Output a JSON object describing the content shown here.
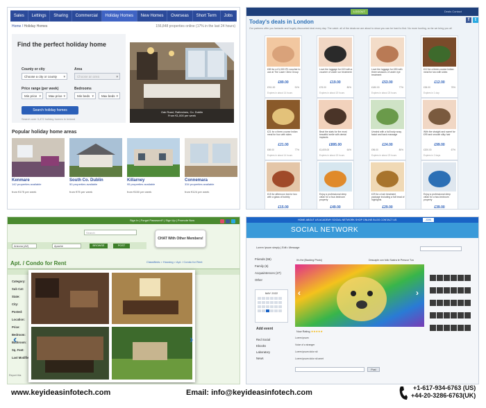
{
  "panel_holiday": {
    "nav": [
      "Sales",
      "Lettings",
      "Sharing",
      "Commercial",
      "Holiday Homes",
      "New Homes",
      "Overseas",
      "Short Term",
      "Jobs"
    ],
    "active_nav": "Holiday Homes",
    "breadcrumb_home": "Home",
    "breadcrumb_current": "Holiday Homes",
    "results_count": "156,848 properties online (17% in the last 24 hours)",
    "search": {
      "title": "Find the perfect holiday home",
      "county_label": "County or city",
      "county_value": "Choose a city or county",
      "area_label": "Area",
      "area_value": "Choose an area",
      "price_label": "Price range (per week)",
      "min_price": "Min price",
      "max_price": "Max price",
      "beds_label": "Bedrooms",
      "min_beds": "Min beds",
      "max_beds": "Max beds",
      "button": "Search holiday homes",
      "note": "Search over 3,472 holiday homes in Ireland"
    },
    "featured_caption": "Oak Road, Rathmines, Co. Dublin",
    "featured_price": "From €1,000 per week",
    "popular_title": "Popular holiday home areas",
    "areas": [
      {
        "name": "Kenmare",
        "sub": "142 properties available",
        "price": "from €175 per week"
      },
      {
        "name": "South Co. Dublin",
        "sub": "50 properties available",
        "price": "from €75 per week"
      },
      {
        "name": "Killarney",
        "sub": "95 properties available",
        "price": "from €150 per week"
      },
      {
        "name": "Connemara",
        "sub": "334 properties available",
        "price": "from €124 per week"
      }
    ]
  },
  "panel_deals": {
    "title": "Today's deals in London",
    "green_button": "LOGOUT",
    "top_links": "Deals   Contact",
    "intro": "Our partners offer you fantastic and hugely discounted deal every day. The catch: all of the deals we are about to show you can be hard to find. No more hunting, so far we bring you all",
    "deals": [
      {
        "text": "£80 for a £1,000 IPL voucher to use at The Laser Clinic Group",
        "price": "£89.00",
        "you_save": "£911.00",
        "discount": "91%",
        "expires": "Expires in about 14 hours"
      },
      {
        "text": "Love the luggage for £19 with a voucher of under our treatment",
        "price": "£19.00",
        "you_save": "£76.00",
        "discount": "80%",
        "expires": "Expires in about 20 hours"
      },
      {
        "text": "Love the luggage for £53 with three sessions of under eye treatment",
        "price": "£53.00",
        "you_save": "£180.00",
        "discount": "77%",
        "expires": "Expires in about 23 hours"
      },
      {
        "text": "£12 for a three-course Indian meal for two with sides",
        "price": "£12.00",
        "you_save": "£36.00",
        "discount": "75%",
        "expires": "Expires in 1 day"
      },
      {
        "text": "£21 for a three-course Indian meal for four with sides",
        "price": "£21.00",
        "you_save": "£69.00",
        "discount": "77%",
        "expires": "Expires in about 14 hours"
      },
      {
        "text": "Beat the stats for the most beautiful smile with dental implants",
        "price": "£895.00",
        "you_save": "£1,605.00",
        "discount": "64%",
        "expires": "Expires in about 20 hours"
      },
      {
        "text": "Unwind with a full body wrap, facial and back massage",
        "price": "£24.00",
        "you_save": "£96.00",
        "discount": "80%",
        "expires": "Expires in about 23 hours"
      },
      {
        "text": "With the straight and sweet for £99 and smooth silky hair",
        "price": "£99.00",
        "you_save": "£200.00",
        "discount": "67%",
        "expires": "Expires in 2 days"
      },
      {
        "text": "£15 for afternoon tea for two with a glass of bubbly",
        "price": "£15.00",
        "you_save": "£35.00",
        "discount": "70%",
        "expires": "Expires in about 14 hours"
      },
      {
        "text": "Enjoy a professional deep clean for a four-bedroom property",
        "price": "£49.00",
        "you_save": "£151.00",
        "discount": "76%",
        "expires": "Expires in about 20 hours"
      },
      {
        "text": "£29 for a hair treatment package including a full head of highlights",
        "price": "£29.00",
        "you_save": "£121.00",
        "discount": "81%",
        "expires": "Expires in about 23 hours"
      },
      {
        "text": "Enjoy a professional deep clean for a two-bedroom property",
        "price": "£39.00",
        "you_save": "£111.00",
        "discount": "74%",
        "expires": "Expires in 2 days"
      }
    ],
    "price_label": "You save",
    "discount_label": "Discount"
  },
  "panel_condo": {
    "top_links": "Sign In  |  Forgot Password?  |  Sign Up  |  Promote Now",
    "search_placeholder": "Search",
    "chat_bubble": "CHAT With Other Members!",
    "location_value": "Arizona (AZ)",
    "city_value": "Apache",
    "browse_btn": "BROWSE",
    "post_btn": "POST",
    "breadcrumb": "Classifieds > Housing > Apt. / Condo for Rent",
    "heading": "Apt. / Condo for Rent",
    "side_labels": [
      "Category:",
      "Sub Cat:",
      "State:",
      "City:",
      "Posted:",
      "Location:",
      "Price:",
      "Bedroom:",
      "Bathroom:",
      "Sq. Feet:",
      "Last Modified:"
    ],
    "footer": "Report this"
  },
  "panel_social": {
    "nav": "HOME    ABOUT US    ACADEMY    SOCIAL NETWORK    SHOP ONLINE    BLOG    CONTACT US",
    "join": "JOIN",
    "title": "SOCIAL NETWORK",
    "user_line": "Lorem Ipsum simply  |  Edit  •  Message",
    "side_links": [
      "Friends (55)",
      "Family (6)",
      "Acquaintences (27)",
      "Other"
    ],
    "calendar_title": "MAY 2022",
    "add_event": "Add event",
    "groups": [
      "Red Social",
      "Ebooks",
      "Laboratory",
      "News"
    ],
    "caption_left": "It's the [Backing Photo]",
    "caption_right": "Descaple con follo Sastra te Prescor Tzo",
    "rating_label": "Now Rating",
    "comments": [
      "Lorem ipsum",
      "Voice of a stranger",
      "Lorem ipsum dolor sit",
      "Lorem ipsum dolor sit amet"
    ],
    "reply_btn": "Post"
  },
  "footer": {
    "website": "www.keyideasinfotech.com",
    "email": "Email: info@keyideasinfotech.com",
    "phone_us": "+1-617-934-6763 (US)",
    "phone_uk": "+44-20-3286-6763(UK)"
  },
  "colors": {
    "brand_blue": "#2b4a9a",
    "deal_blue": "#2b6fb5",
    "green": "#3d7f29",
    "social_blue": "#1a63c5"
  }
}
